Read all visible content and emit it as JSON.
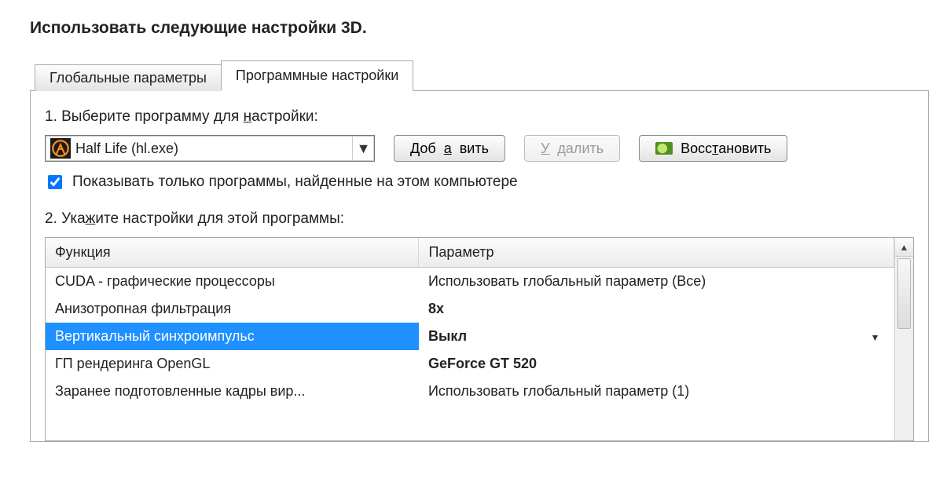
{
  "title": "Использовать следующие настройки 3D.",
  "tabs": {
    "global": "Глобальные параметры",
    "program": "Программные настройки"
  },
  "step1": {
    "prefix": "1. Выберите программу для ",
    "underlined": "н",
    "suffix": "астройки:"
  },
  "program_combo": {
    "label": "Half Life (hl.exe)"
  },
  "buttons": {
    "add_pre": "Доб",
    "add_u": "а",
    "add_post": "вить",
    "remove_pre": "",
    "remove_u": "У",
    "remove_post": "далить",
    "restore_pre": "Восс",
    "restore_u": "т",
    "restore_post": "ановить"
  },
  "checkbox": {
    "checked": true,
    "label": "Показывать только программы, найденные на этом компьютере"
  },
  "step2": {
    "prefix": "2. Ука",
    "underlined": "ж",
    "suffix": "ите настройки для этой программы:"
  },
  "columns": {
    "feature": "Функция",
    "param": "Параметр"
  },
  "rows": [
    {
      "feature": "CUDA - графические процессоры",
      "param": "Использовать глобальный параметр (Все)",
      "bold": false,
      "selected": false,
      "dropdown": false
    },
    {
      "feature": "Анизотропная фильтрация",
      "param": "8x",
      "bold": true,
      "selected": false,
      "dropdown": false
    },
    {
      "feature": "Вертикальный синхроимпульс",
      "param": "Выкл",
      "bold": true,
      "selected": true,
      "dropdown": true
    },
    {
      "feature": "ГП рендеринга OpenGL",
      "param": "GeForce GT 520",
      "bold": true,
      "selected": false,
      "dropdown": false
    },
    {
      "feature": "Заранее подготовленные кадры вир...",
      "param": "Использовать глобальный параметр (1)",
      "bold": false,
      "selected": false,
      "dropdown": false
    }
  ]
}
